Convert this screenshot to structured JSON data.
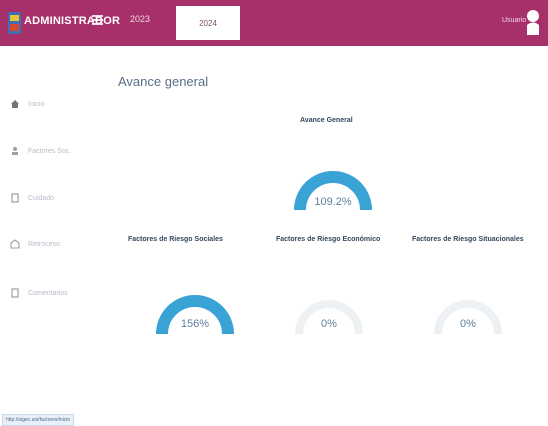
{
  "header": {
    "app_title": "ADMINISTRADOR",
    "years": [
      "2023",
      "2024"
    ],
    "selected_year": "2024",
    "user_label": "Usuario"
  },
  "sidebar": {
    "items": [
      {
        "label": "Inicio",
        "icon": "home-icon"
      },
      {
        "label": "Factores Soc.",
        "icon": "people-icon"
      },
      {
        "label": "Cuidado",
        "icon": "document-icon"
      },
      {
        "label": "Retroceso",
        "icon": "building-icon"
      },
      {
        "label": "Comentarios",
        "icon": "document-icon"
      }
    ]
  },
  "status_bar": {
    "url": "http://sigec.uni/factores/inicio"
  },
  "main": {
    "heading": "Avance general",
    "gauges": [
      {
        "title": "Avance General",
        "value_text": "109.2%",
        "fill": 1.0
      },
      {
        "title": "Factores de Riesgo Sociales",
        "value_text": "156%",
        "fill": 1.0
      },
      {
        "title": "Factores de Riesgo Económico",
        "value_text": "0%",
        "fill": 0
      },
      {
        "title": "Factores de Riesgo Situacionales",
        "value_text": "0%",
        "fill": 0
      }
    ]
  },
  "colors": {
    "topbar": "#a8306a",
    "gauge_fill": "#3aa3d6",
    "gauge_track": "#eef1f4",
    "sidebar_text": "#b7bcc7"
  }
}
